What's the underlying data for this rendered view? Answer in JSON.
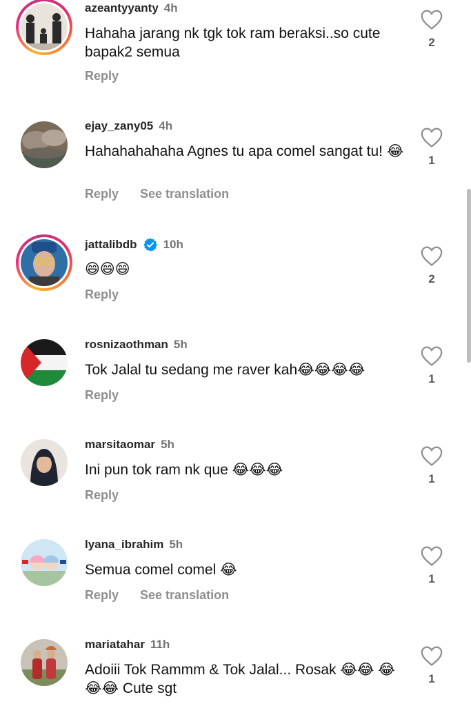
{
  "comments": [
    {
      "username": "azeantyyanty",
      "time": "4h",
      "text": "Hahaha jarang nk tgk tok ram beraksi..so cute bapak2 semua",
      "reply": "Reply",
      "likes": "2"
    },
    {
      "username": "ejay_zany05",
      "time": "4h",
      "text": "Hahahahahaha Agnes tu apa comel sangat tu! 😂",
      "reply": "Reply",
      "see_translation": "See translation",
      "likes": "1"
    },
    {
      "username": "jattalibdb",
      "time": "10h",
      "text": "😄😄😄",
      "reply": "Reply",
      "likes": "2"
    },
    {
      "username": "rosnizaothman",
      "time": "5h",
      "text": "Tok Jalal tu sedang me raver kah😂😂😂😂",
      "reply": "Reply",
      "likes": "1"
    },
    {
      "username": "marsitaomar",
      "time": "5h",
      "text": "Ini pun tok ram nk que 😂😂😂",
      "reply": "Reply",
      "likes": "1"
    },
    {
      "username": "lyana_ibrahim",
      "time": "5h",
      "text": "Semua comel comel 😂",
      "reply": "Reply",
      "see_translation": "See translation",
      "likes": "1"
    },
    {
      "username": "mariatahar",
      "time": "11h",
      "text": "Adoiii Tok Rammm & Tok Jalal... Rosak 😂😂 😂😂😂 Cute sgt",
      "likes": "1"
    }
  ],
  "icons": {
    "like": "heart-outline-icon",
    "verified": "verified-badge-icon"
  },
  "colors": {
    "username": "#262626",
    "meta": "#737373",
    "action": "#8e8e8e",
    "verified": "#0095f6"
  }
}
